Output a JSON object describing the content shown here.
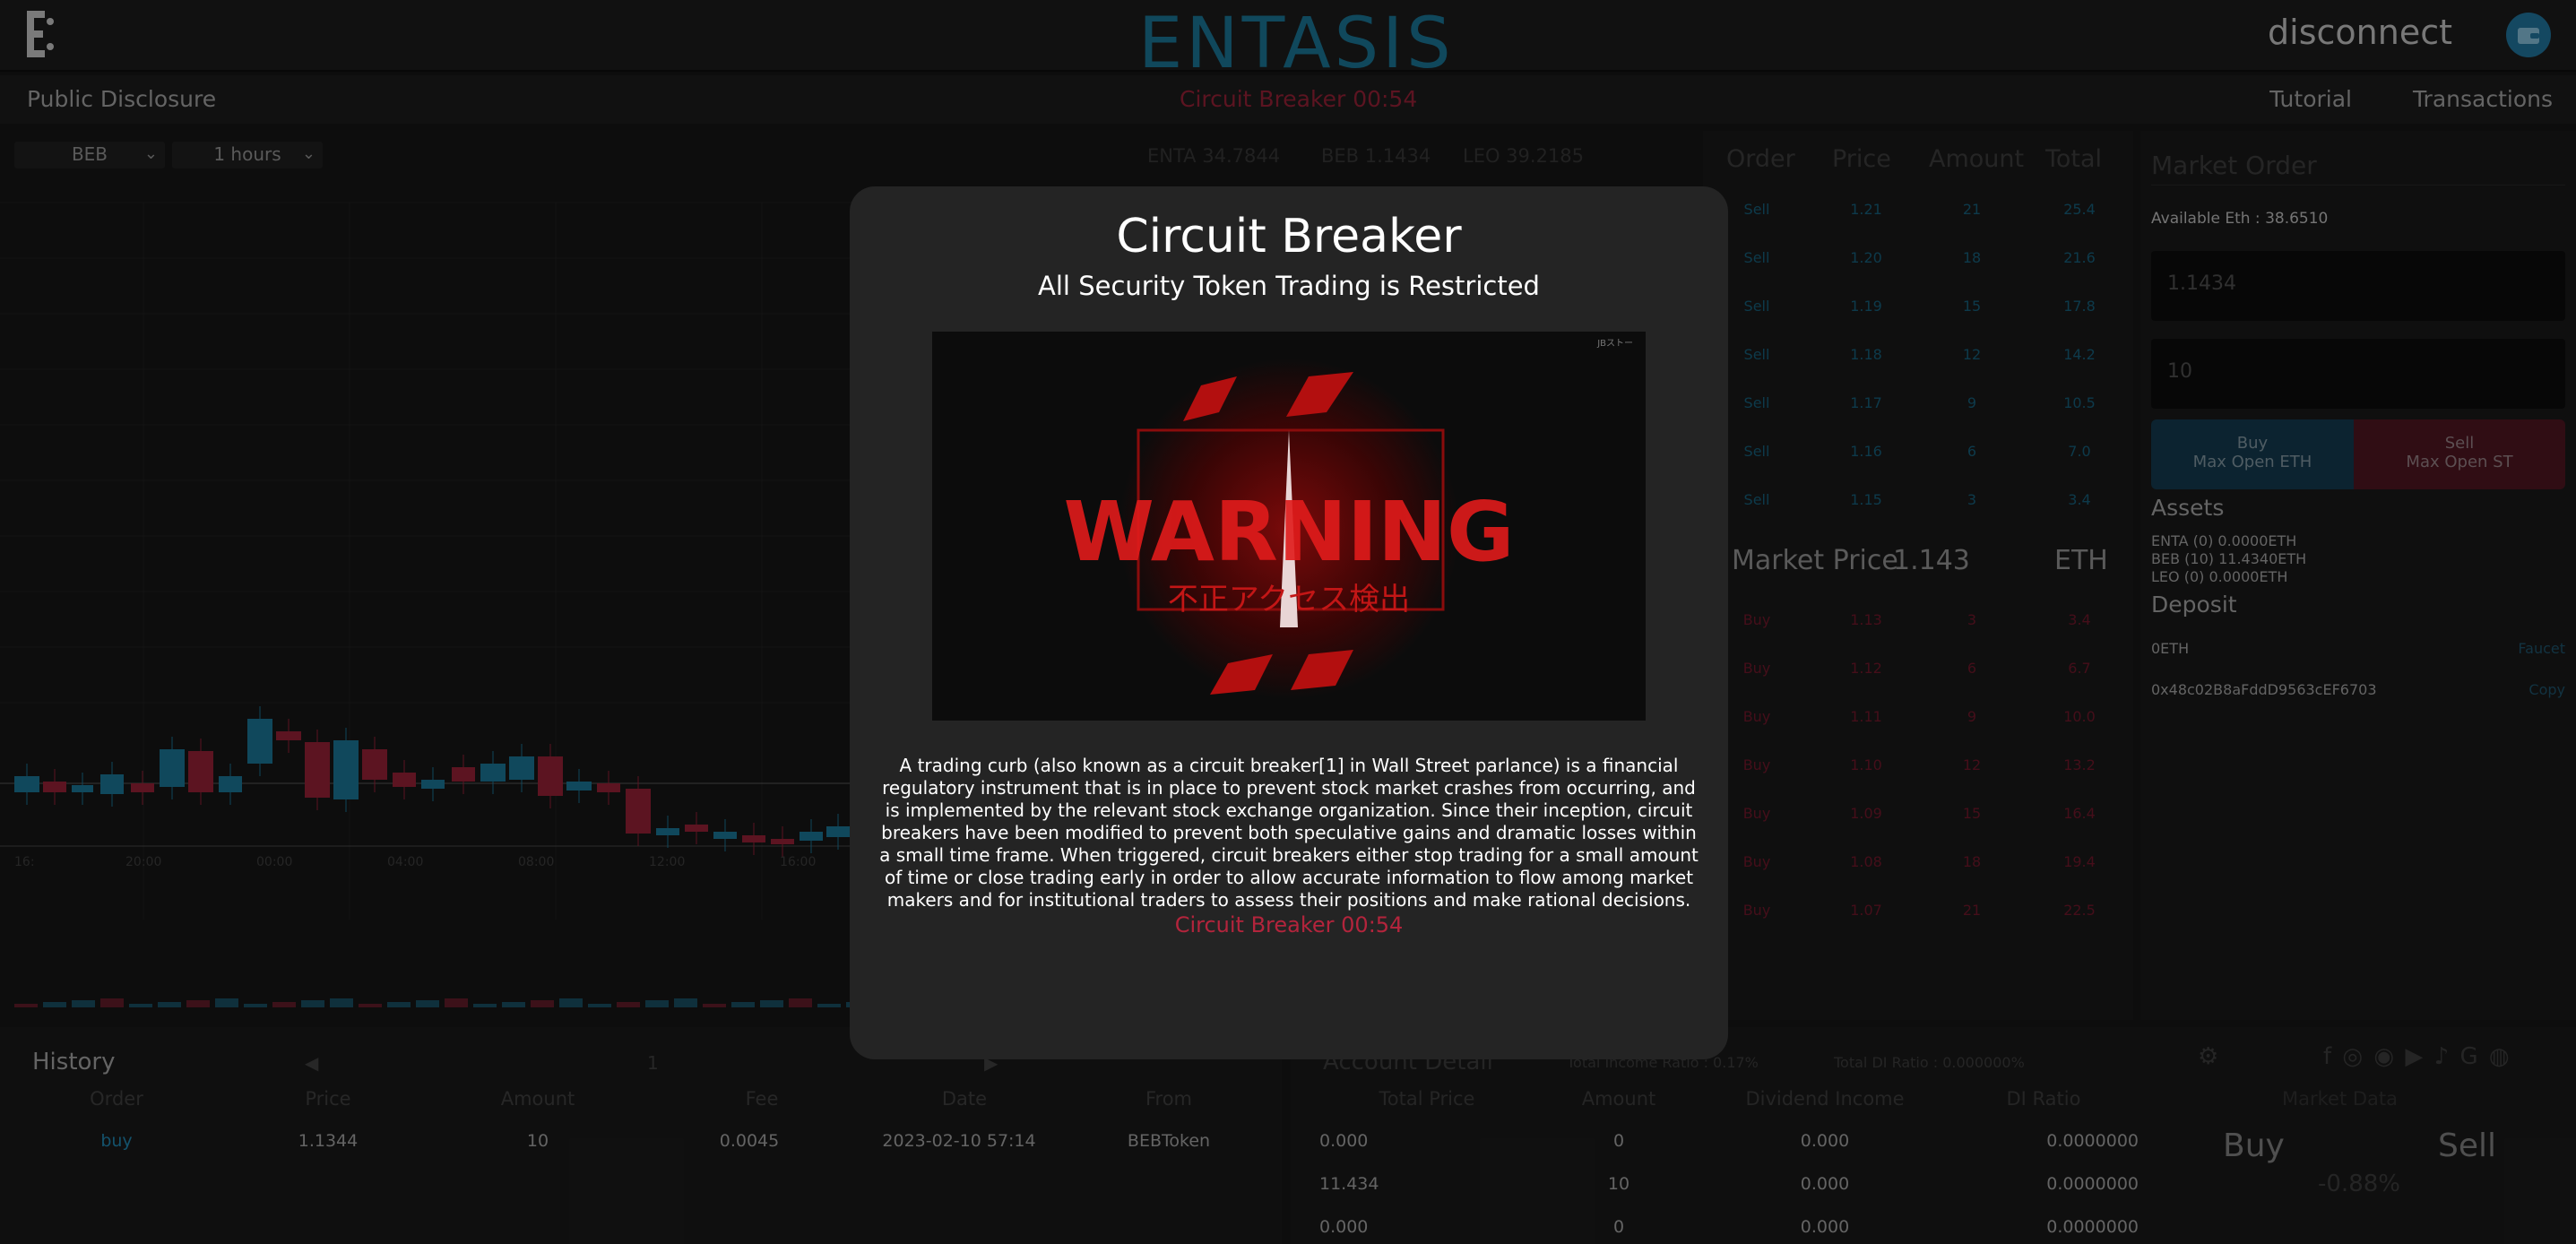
{
  "header": {
    "brand": "ENTASIS",
    "disconnect_label": "disconnect"
  },
  "subbar": {
    "left": "Public Disclosure",
    "center": "Circuit Breaker 00:54",
    "tutorial": "Tutorial",
    "transactions": "Transactions"
  },
  "chart": {
    "token_select": "BEB",
    "interval_select": "1 hours",
    "tickers": [
      {
        "text": "ENTA  34.7844"
      },
      {
        "text": "BEB  1.1434"
      },
      {
        "text": "LEO  39.2185"
      }
    ],
    "x_ticks": [
      "16:",
      "20:00",
      "00:00",
      "04:00",
      "08:00",
      "12:00",
      "16:00"
    ]
  },
  "order_book": {
    "headers": [
      "Order",
      "Price",
      "Amount",
      "Total"
    ],
    "sells": [
      {
        "order": "Sell",
        "price": "1.21",
        "amount": "21",
        "total": "25.4"
      },
      {
        "order": "Sell",
        "price": "1.20",
        "amount": "18",
        "total": "21.6"
      },
      {
        "order": "Sell",
        "price": "1.19",
        "amount": "15",
        "total": "17.8"
      },
      {
        "order": "Sell",
        "price": "1.18",
        "amount": "12",
        "total": "14.2"
      },
      {
        "order": "Sell",
        "price": "1.17",
        "amount": "9",
        "total": "10.5"
      },
      {
        "order": "Sell",
        "price": "1.16",
        "amount": "6",
        "total": "7.0"
      },
      {
        "order": "Sell",
        "price": "1.15",
        "amount": "3",
        "total": "3.4"
      }
    ],
    "market_price_label": "Market Price",
    "market_price_value": "1.143",
    "market_price_unit": "ETH",
    "buys": [
      {
        "order": "Buy",
        "price": "1.13",
        "amount": "3",
        "total": "3.4"
      },
      {
        "order": "Buy",
        "price": "1.12",
        "amount": "6",
        "total": "6.7"
      },
      {
        "order": "Buy",
        "price": "1.11",
        "amount": "9",
        "total": "10.0"
      },
      {
        "order": "Buy",
        "price": "1.10",
        "amount": "12",
        "total": "13.2"
      },
      {
        "order": "Buy",
        "price": "1.09",
        "amount": "15",
        "total": "16.4"
      },
      {
        "order": "Buy",
        "price": "1.08",
        "amount": "18",
        "total": "19.4"
      },
      {
        "order": "Buy",
        "price": "1.07",
        "amount": "21",
        "total": "22.5"
      }
    ]
  },
  "market_order": {
    "title": "Market Order",
    "available": "Available Eth : 38.6510",
    "price_value": "1.1434",
    "amount_value": "10",
    "buy_line1": "Buy",
    "buy_line2": "Max Open ETH",
    "sell_line1": "Sell",
    "sell_line2": "Max Open ST",
    "assets_title": "Assets",
    "assets": [
      "ENTA (0) 0.0000ETH",
      "BEB (10) 11.4340ETH",
      "LEO (0) 0.0000ETH"
    ],
    "deposit_title": "Deposit",
    "deposit_value": "0ETH",
    "faucet_label": "Faucet",
    "address": "0x48c02B8aFddD9563cEF6703",
    "copy_label": "Copy"
  },
  "history": {
    "title": "History",
    "pager_prev": "◀",
    "pager_page": "1",
    "pager_next": "▶",
    "headers": [
      "Order",
      "Price",
      "Amount",
      "Fee",
      "Date",
      "From"
    ],
    "rows": [
      {
        "order": "buy",
        "price": "1.1344",
        "amount": "10",
        "fee": "0.0045",
        "date": "2023-02-10 57:14",
        "from": "BEBToken"
      }
    ]
  },
  "account": {
    "title": "Account Detail",
    "total_income": "Total Income Ratio : 0.17%",
    "total_di": "Total DI Ratio : 0.000000%",
    "headers": [
      "Total Price",
      "Amount",
      "Dividend Income",
      "DI Ratio"
    ],
    "rows": [
      {
        "total": "0.000",
        "amount": "0",
        "dividend": "0.000",
        "ratio": "0.0000000"
      },
      {
        "total": "11.434",
        "amount": "10",
        "dividend": "0.000",
        "ratio": "0.0000000"
      },
      {
        "total": "0.000",
        "amount": "0",
        "dividend": "0.000",
        "ratio": "0.0000000"
      }
    ],
    "market_data_label": "Market Data",
    "md_buy": "Buy",
    "md_sell": "Sell",
    "md_change": "-0.88%",
    "social_icons": [
      "opensea-icon",
      "facebook-icon",
      "instagram-icon",
      "reddit-icon",
      "youtube-icon",
      "tiktok-icon",
      "google-icon",
      "github-icon"
    ]
  },
  "modal": {
    "title": "Circuit Breaker",
    "subtitle": "All Security Token Trading is Restricted",
    "image_text": "WARNING",
    "image_subtext": "不正アクセス検出",
    "image_corner": "JBストー",
    "body": "A trading curb (also known as a circuit breaker[1] in Wall Street parlance) is a financial regulatory instrument that is in place to prevent stock market crashes from occurring, and is implemented by the relevant stock exchange organization. Since their inception, circuit breakers have been modified to prevent both speculative gains and dramatic losses within a small time frame. When triggered, circuit breakers either stop trading for a small amount of time or close trading early in order to allow accurate information to flow among market makers and for institutional traders to assess their positions and make rational decisions.",
    "timer": "Circuit Breaker 00:54"
  },
  "colors": {
    "accent": "#1a6f8e",
    "sell": "#1f7fa6",
    "buy": "#b3243c",
    "timer": "#b3243c"
  }
}
